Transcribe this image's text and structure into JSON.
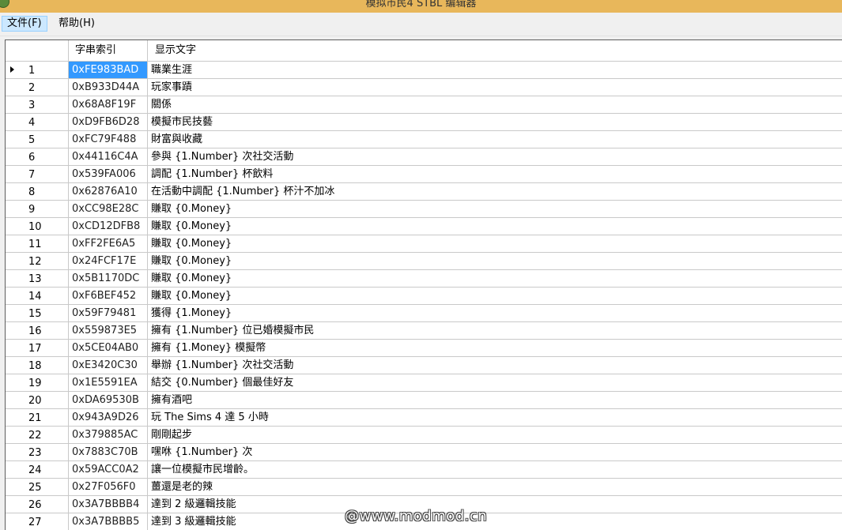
{
  "window": {
    "title": "模拟市民4 STBL 编辑器"
  },
  "menu": {
    "items": [
      {
        "label": "文件(F)",
        "active": true
      },
      {
        "label": "帮助(H)",
        "active": false
      }
    ]
  },
  "grid": {
    "columns": {
      "key": "字串索引",
      "text": "显示文字"
    },
    "selected_row": 1,
    "rows": [
      {
        "num": "1",
        "key": "0xFE983BAD",
        "text": "職業生涯"
      },
      {
        "num": "2",
        "key": "0xB933D44A",
        "text": "玩家事蹟"
      },
      {
        "num": "3",
        "key": "0x68A8F19F",
        "text": "關係"
      },
      {
        "num": "4",
        "key": "0xD9FB6D28",
        "text": "模擬市民技藝"
      },
      {
        "num": "5",
        "key": "0xFC79F488",
        "text": "財富與收藏"
      },
      {
        "num": "6",
        "key": "0x44116C4A",
        "text": "參與 {1.Number} 次社交活動"
      },
      {
        "num": "7",
        "key": "0x539FA006",
        "text": "調配 {1.Number} 杯飲料"
      },
      {
        "num": "8",
        "key": "0x62876A10",
        "text": "在活動中調配 {1.Number} 杯汁不加冰"
      },
      {
        "num": "9",
        "key": "0xCC98E28C",
        "text": "賺取 {0.Money}"
      },
      {
        "num": "10",
        "key": "0xCD12DFB8",
        "text": "賺取 {0.Money}"
      },
      {
        "num": "11",
        "key": "0xFF2FE6A5",
        "text": "賺取 {0.Money}"
      },
      {
        "num": "12",
        "key": "0x24FCF17E",
        "text": "賺取 {0.Money}"
      },
      {
        "num": "13",
        "key": "0x5B1170DC",
        "text": "賺取 {0.Money}"
      },
      {
        "num": "14",
        "key": "0xF6BEF452",
        "text": "賺取 {0.Money}"
      },
      {
        "num": "15",
        "key": "0x59F79481",
        "text": "獲得 {1.Money}"
      },
      {
        "num": "16",
        "key": "0x559873E5",
        "text": "擁有 {1.Number} 位已婚模擬市民"
      },
      {
        "num": "17",
        "key": "0x5CE04AB0",
        "text": "擁有 {1.Money} 模擬幣"
      },
      {
        "num": "18",
        "key": "0xE3420C30",
        "text": "舉辦 {1.Number} 次社交活動"
      },
      {
        "num": "19",
        "key": "0x1E5591EA",
        "text": "結交 {0.Number} 個最佳好友"
      },
      {
        "num": "20",
        "key": "0xDA69530B",
        "text": "擁有酒吧"
      },
      {
        "num": "21",
        "key": "0x943A9D26",
        "text": "玩 The Sims 4 達 5 小時"
      },
      {
        "num": "22",
        "key": "0x379885AC",
        "text": "剛剛起步"
      },
      {
        "num": "23",
        "key": "0x7883C70B",
        "text": "嘿咻 {1.Number} 次"
      },
      {
        "num": "24",
        "key": "0x59ACC0A2",
        "text": "讓一位模擬市民增齡。"
      },
      {
        "num": "25",
        "key": "0x27F056F0",
        "text": "薑還是老的辣"
      },
      {
        "num": "26",
        "key": "0x3A7BBBB4",
        "text": "達到 2 級邏輯技能"
      },
      {
        "num": "27",
        "key": "0x3A7BBBB5",
        "text": "達到 3 級邏輯技能"
      }
    ]
  },
  "watermark": "@www.modmod.cn"
}
